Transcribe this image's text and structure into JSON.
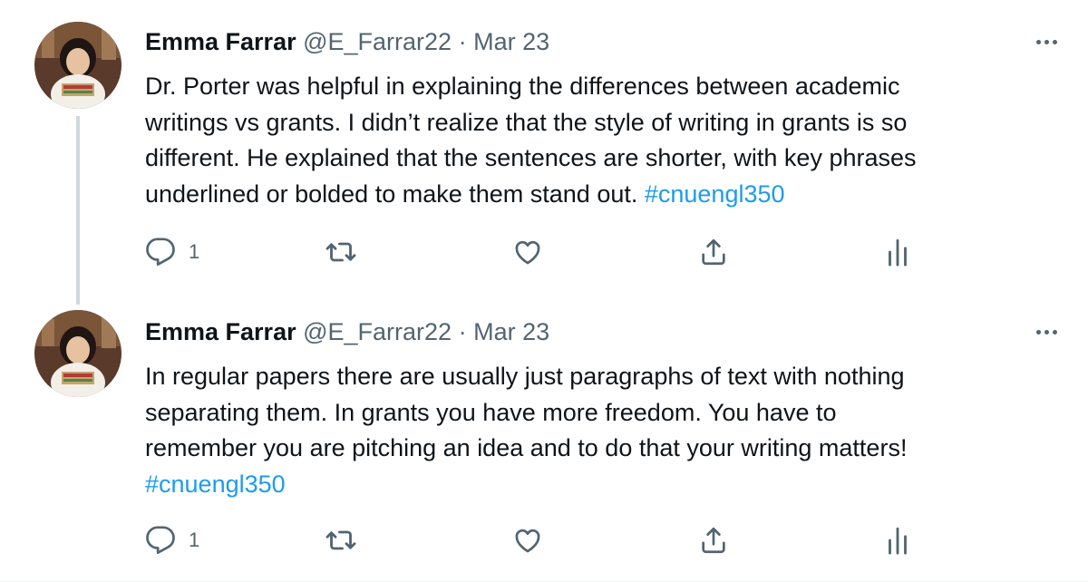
{
  "tweets": [
    {
      "author_name": "Emma Farrar",
      "handle": "@E_Farrar22",
      "separator": "·",
      "date": "Mar 23",
      "text_lines": [
        "Dr. Porter was helpful in explaining the differences between academic",
        "writings vs grants. I didn’t realize that the style of writing in grants is so",
        "different. He explained that the sentences are shorter, with key phrases",
        "underlined or bolded to make them stand out. "
      ],
      "hashtag": "#cnuengl350",
      "reply_count": "1"
    },
    {
      "author_name": "Emma Farrar",
      "handle": "@E_Farrar22",
      "separator": "·",
      "date": "Mar 23",
      "text_lines": [
        "In regular papers there are usually just paragraphs of text with nothing",
        "separating them. In grants you have more freedom. You have to",
        "remember you are pitching an idea and to do that your writing matters!"
      ],
      "hashtag": "#cnuengl350",
      "reply_count": "1"
    }
  ],
  "icons": [
    "reply-icon",
    "retweet-icon",
    "like-icon",
    "share-icon",
    "analytics-icon",
    "more-icon"
  ],
  "colors": {
    "link": "#1d9bf0",
    "muted": "#536471",
    "text": "#0f1419",
    "thread_line": "#cfd9de"
  }
}
